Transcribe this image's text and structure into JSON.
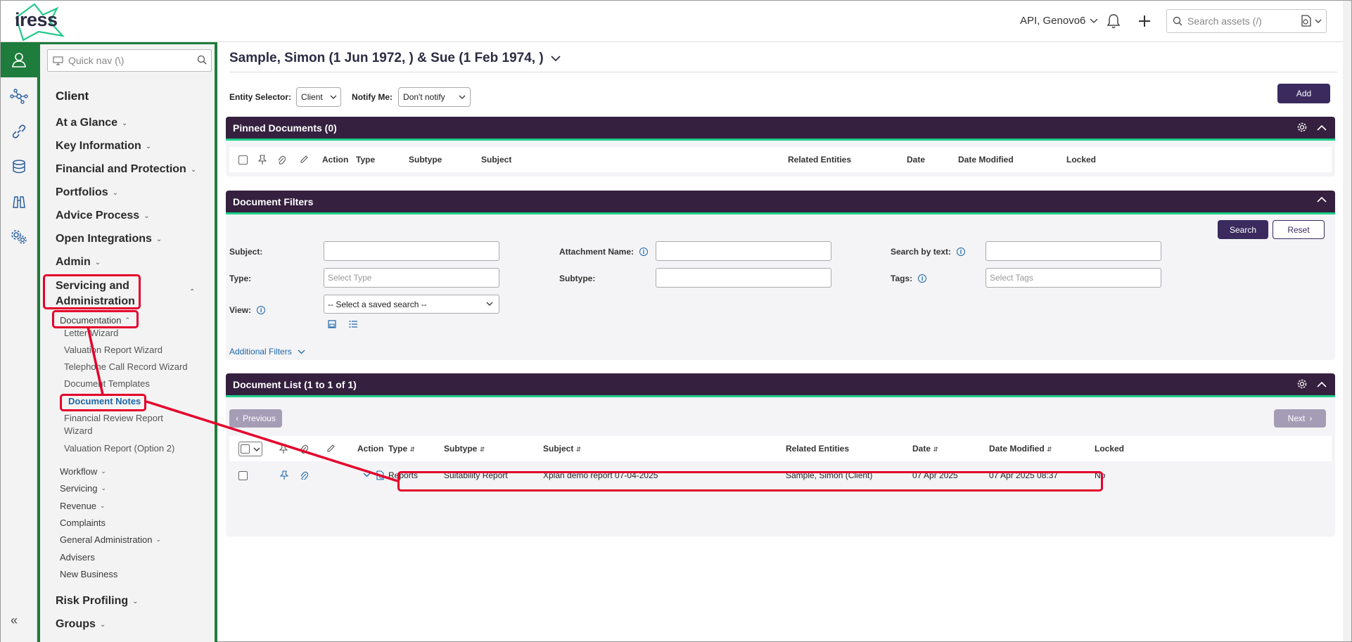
{
  "topbar": {
    "logo_text": "iress",
    "user": "API, Genovo6",
    "search_placeholder": "Search assets (/)"
  },
  "rail": {
    "items": [
      "user-icon",
      "network-icon",
      "link-icon",
      "database-icon",
      "binoculars-icon",
      "settings-icon"
    ],
    "collapse": "«"
  },
  "sidebar": {
    "quicknav_placeholder": "Quick nav (\\)",
    "title": "Client",
    "items": [
      {
        "label": "At a Glance"
      },
      {
        "label": "Key Information"
      },
      {
        "label": "Financial and Protection"
      },
      {
        "label": "Portfolios"
      },
      {
        "label": "Advice Process"
      },
      {
        "label": "Open Integrations"
      },
      {
        "label": "Admin"
      }
    ],
    "servicing_line1": "Servicing and",
    "servicing_line2": "Administration",
    "documentation": "Documentation",
    "doc_items": [
      "Letter Wizard",
      "Valuation Report Wizard",
      "Telephone Call Record Wizard",
      "Document Templates",
      "Document Notes",
      "Financial Review Report",
      "Wizard",
      "Valuation Report (Option 2)"
    ],
    "sub_items": [
      {
        "label": "Workflow",
        "chev": true
      },
      {
        "label": "Servicing",
        "chev": true
      },
      {
        "label": "Revenue",
        "chev": true
      },
      {
        "label": "Complaints",
        "chev": false
      },
      {
        "label": "General Administration",
        "chev": true
      },
      {
        "label": "Advisers",
        "chev": false
      },
      {
        "label": "New Business",
        "chev": false
      }
    ],
    "bottom_items": [
      {
        "label": "Risk Profiling"
      },
      {
        "label": "Groups"
      }
    ]
  },
  "main": {
    "client_title": "Sample, Simon (1 Jun 1972, ) & Sue (1 Feb 1974, )",
    "entity_selector_label": "Entity Selector:",
    "entity_selector_value": "Client",
    "notify_label": "Notify Me:",
    "notify_value": "Don't notify",
    "add_label": "Add",
    "pinned": {
      "title": "Pinned Documents (0)",
      "columns": [
        "Action",
        "Type",
        "Subtype",
        "Subject",
        "Related Entities",
        "Date",
        "Date Modified",
        "Locked"
      ]
    },
    "filters": {
      "title": "Document Filters",
      "search_label": "Search",
      "reset_label": "Reset",
      "subject_label": "Subject:",
      "type_label": "Type:",
      "type_placeholder": "Select Type",
      "view_label": "View:",
      "view_value": "-- Select a saved search --",
      "attachment_label": "Attachment Name:",
      "subtype_label": "Subtype:",
      "search_text_label": "Search by text:",
      "tags_label": "Tags:",
      "tags_placeholder": "Select Tags",
      "additional_filters": "Additional Filters"
    },
    "list": {
      "title": "Document List (1 to 1 of 1)",
      "previous": "Previous",
      "next": "Next",
      "columns": [
        "Action",
        "Type",
        "Subtype",
        "Subject",
        "Related Entities",
        "Date",
        "Date Modified",
        "Locked"
      ],
      "rows": [
        {
          "type": "Reports",
          "subtype": "Suitability Report",
          "subject": "Xplan demo report 07-04-2025",
          "related": "Sample, Simon (Client)",
          "date": "07 Apr 2025",
          "modified": "07 Apr 2025 08:37",
          "locked": "No"
        }
      ]
    }
  },
  "colors": {
    "accent_green": "#1e7c3c",
    "header_purple": "#35203f",
    "highlight_red": "#e4002b",
    "teal_line": "#1ecf8a"
  }
}
